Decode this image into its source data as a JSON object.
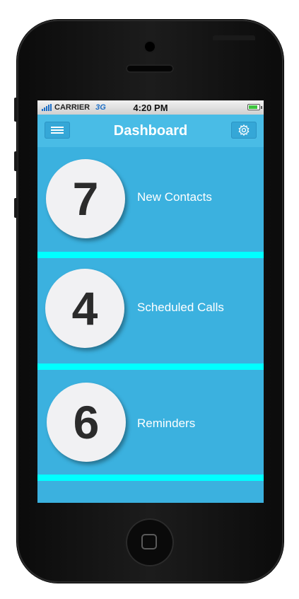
{
  "status_bar": {
    "carrier": "CARRIER",
    "network": "3G",
    "time": "4:20 PM"
  },
  "nav": {
    "title": "Dashboard",
    "menu_icon": "menu-icon",
    "settings_icon": "gear-icon"
  },
  "tiles": [
    {
      "count": "7",
      "label": "New Contacts"
    },
    {
      "count": "4",
      "label": "Scheduled Calls"
    },
    {
      "count": "6",
      "label": "Reminders"
    }
  ],
  "colors": {
    "screen_bg": "#3bb1df",
    "navbar_bg": "#49bce6",
    "separator": "#00ffff",
    "circle_bg": "#f1f1f3"
  }
}
